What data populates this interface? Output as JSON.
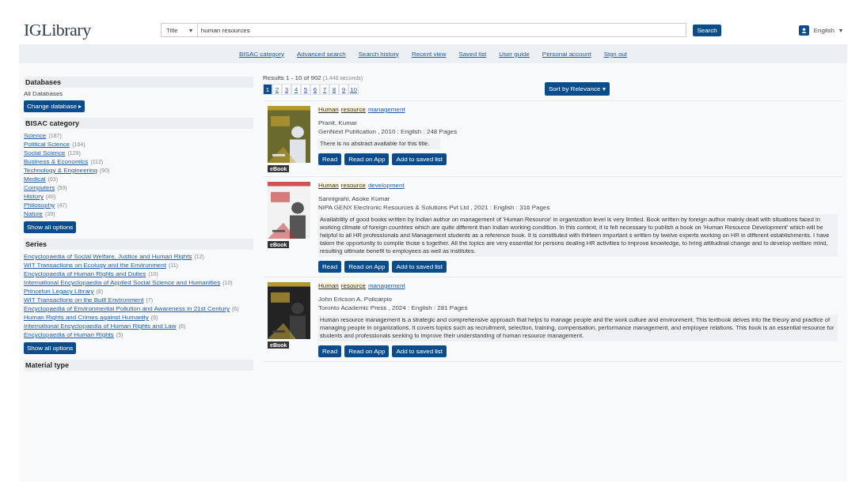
{
  "header": {
    "logo": "IGLibrary",
    "search_field_type": "Title",
    "search_field_caret": "▾",
    "search_value": "human resources",
    "search_button": "Search",
    "language": "English",
    "language_caret": "▾"
  },
  "nav": [
    "BISAC category",
    "Advanced search",
    "Search history",
    "Recent view",
    "Saved list",
    "User guide",
    "Personal account",
    "Sign out"
  ],
  "sidebar": {
    "sections": [
      {
        "kind": "databases",
        "title": "Databases",
        "text": "All Databases",
        "button": "Change database ▸"
      },
      {
        "kind": "facets",
        "title": "BISAC category",
        "items": [
          {
            "label": "Science",
            "count": "(187)"
          },
          {
            "label": "Political Science",
            "count": "(164)"
          },
          {
            "label": "Social Science",
            "count": "(129)"
          },
          {
            "label": "Business & Economics",
            "count": "(112)"
          },
          {
            "label": "Technology & Engineering",
            "count": "(90)"
          },
          {
            "label": "Medical",
            "count": "(63)"
          },
          {
            "label": "Computers",
            "count": "(59)"
          },
          {
            "label": "History",
            "count": "(49)"
          },
          {
            "label": "Philosophy",
            "count": "(47)"
          },
          {
            "label": "Nature",
            "count": "(39)"
          }
        ],
        "button": "Show all options"
      },
      {
        "kind": "facets",
        "title": "Series",
        "items": [
          {
            "label": "Encyclopaedia of Social Welfare, Justice and Human Rights",
            "count": "(12)"
          },
          {
            "label": "WIT Transactions on Ecology and the Environment",
            "count": "(11)"
          },
          {
            "label": "Encyclopaedia of Human Rights and Duties",
            "count": "(10)"
          },
          {
            "label": "International Encyclopaedia of Applied Social Science and Humanities",
            "count": "(10)"
          },
          {
            "label": "Princeton Legacy Library",
            "count": "(8)"
          },
          {
            "label": "WIT Transactions on the Built Environment",
            "count": "(7)"
          },
          {
            "label": "Encyclopaedia of Environmental Pollution and Awareness in 21st Century",
            "count": "(6)"
          },
          {
            "label": "Human Rights and Crimes against Humanity",
            "count": "(6)"
          },
          {
            "label": "International Encyclopaedia of Human Rights and Law",
            "count": "(6)"
          },
          {
            "label": "Encyclopaedia of Human Rights",
            "count": "(5)"
          }
        ],
        "button": "Show all options"
      },
      {
        "kind": "heading",
        "title": "Material type"
      }
    ]
  },
  "results": {
    "summary": "Results 1 - 10 of 902",
    "time": "(1.446 seconds)",
    "pages": [
      {
        "label": "1",
        "selected": true
      },
      {
        "label": "2",
        "selected": false
      },
      {
        "label": "3",
        "selected": false
      },
      {
        "label": "4",
        "selected": false
      },
      {
        "label": "5",
        "selected": false
      },
      {
        "label": "6",
        "selected": false
      },
      {
        "label": "7",
        "selected": false
      },
      {
        "label": "8",
        "selected": false
      },
      {
        "label": "9",
        "selected": false
      },
      {
        "label": "10",
        "selected": false
      }
    ],
    "sort_button": "Sort by Relevance ▾",
    "items": [
      {
        "badge": "eBook",
        "title": [
          {
            "text": "Human",
            "highlighted": true
          },
          {
            "text": "resource",
            "highlighted": true
          },
          {
            "text": "management",
            "highlighted": false
          }
        ],
        "author": "Pranit, Kumar",
        "meta": "GenNext Publication , 2010 : English : 248 Pages",
        "abstract": "There is no abstract available for this title.",
        "buttons": [
          "Read",
          "Read on App",
          "Add to saved list"
        ]
      },
      {
        "badge": "eBook",
        "title": [
          {
            "text": "Human",
            "highlighted": true
          },
          {
            "text": "resource",
            "highlighted": true
          },
          {
            "text": "development",
            "highlighted": false
          }
        ],
        "author": "Sannigrahi, Asoke Kumar",
        "meta": "NIPA GENX Electronic Resources & Solutions Pvt Ltd , 2021 : English : 316 Pages",
        "abstract": "Availability of good books written by Indian author on management of 'Human Resource' in organization level is very limited. Book written by foreign author mainly dealt with situations faced in working climate of foreign countries which are quite different than Indian working condition. In this context, it is felt necessary to publish a book on 'Human Resource Development' which will be helpful to all HR professionals and Management students as a reference book. It is constituted with thirteen important s written by twelve experts working on HR in different establishments. I have taken the opportunity to compile those s together. All the topics are very essential for persons dealing HR activities to improve knowledge, to bring attitudinal change and to develop welfare mind, resulting ultimate benefit to employees as well as institutes.",
        "buttons": [
          "Read",
          "Read on App",
          "Add to saved list"
        ]
      },
      {
        "badge": "eBook",
        "title": [
          {
            "text": "Human",
            "highlighted": true
          },
          {
            "text": "resource",
            "highlighted": true
          },
          {
            "text": "management",
            "highlighted": false
          }
        ],
        "author": "John Ericson A. Policarpio",
        "meta": "Toronto Academic Press , 2024 : English : 281 Pages",
        "abstract": "Human resource management is a strategic and comprehensive approach that helps to manage people and the work culture and environment. This textbook delves into the theory and practice of managing people in organizations. It covers topics such as recruitment, selection, training, compensation, performance management, and employee relations. This book is an essential resource for students and professionals seeking to improve their understanding of human resource management.",
        "buttons": [
          "Read",
          "Read on App",
          "Add to saved list"
        ]
      }
    ]
  }
}
